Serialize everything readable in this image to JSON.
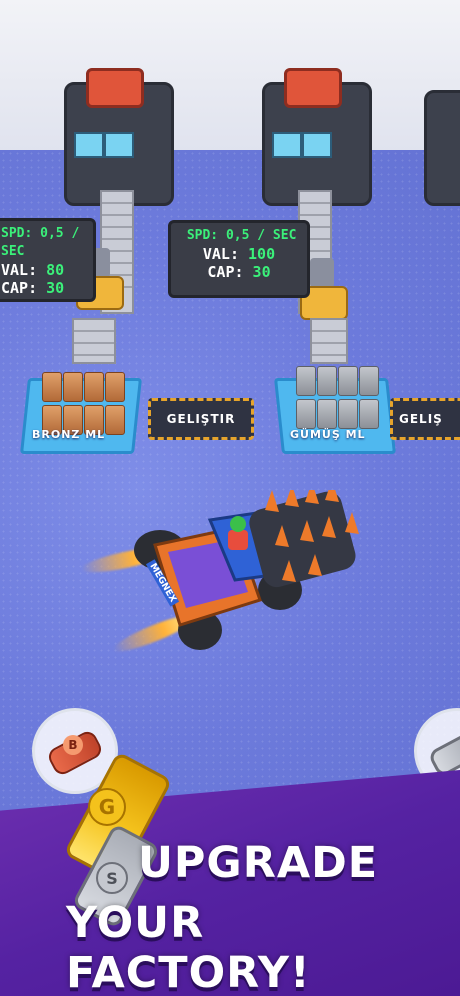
{
  "stations": [
    {
      "spd": "SPD: 0,5 / SEC",
      "val_label": "VAL:",
      "val": "80",
      "cap_label": "CAP:",
      "cap": "30"
    },
    {
      "spd": "SPD: 0,5 / SEC",
      "val_label": "VAL:",
      "val": "100",
      "cap_label": "CAP:",
      "cap": "30"
    }
  ],
  "pads": {
    "bronze_label": "BRONZ ML",
    "silver_label": "GÜMÜŞ ML",
    "upgrade_1": "GELIŞTIR",
    "upgrade_2": "GELIŞ"
  },
  "vehicle": {
    "brand": "MEGNEX"
  },
  "ingots": {
    "bronze_letter": "B",
    "gold_letter": "G",
    "silver_letter": "S"
  },
  "headline": {
    "line1": "UPGRADE",
    "line2": "YOUR FACTORY!"
  },
  "colors": {
    "floor": "#6a78d8",
    "banner": "#5522a2",
    "accent_green": "#3bf07a",
    "pad_blue": "#4fb8ef"
  }
}
